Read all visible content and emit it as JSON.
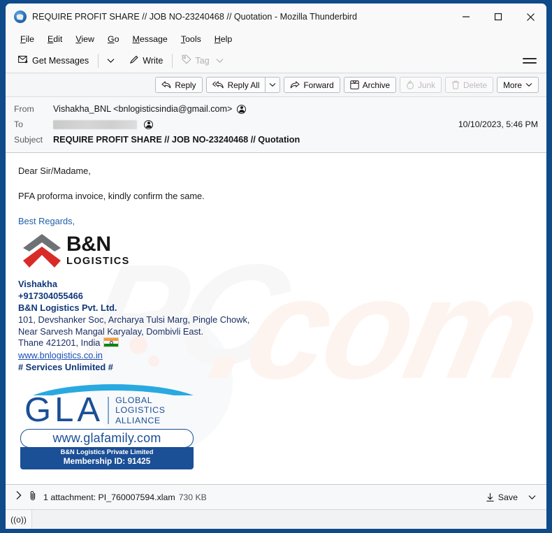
{
  "window": {
    "title": "REQUIRE PROFIT SHARE // JOB NO-23240468 // Quotation - Mozilla Thunderbird",
    "app_icon": "thunderbird-icon",
    "minimize_label": "minimize-icon",
    "maximize_label": "maximize-icon",
    "close_label": "close-icon",
    "border_color": "#0f4a8a"
  },
  "menubar": {
    "items": [
      {
        "accel": "F",
        "rest": "ile"
      },
      {
        "accel": "E",
        "rest": "dit"
      },
      {
        "accel": "V",
        "rest": "iew"
      },
      {
        "accel": "G",
        "rest": "o"
      },
      {
        "accel": "M",
        "rest": "essage"
      },
      {
        "accel": "T",
        "rest": "ools"
      },
      {
        "accel": "H",
        "rest": "elp"
      }
    ]
  },
  "toolbar": {
    "get_messages_label": "Get Messages",
    "get_messages_icon": "envelope-download-icon",
    "get_messages_chevron": "chevron-down-icon",
    "write_label": "Write",
    "write_icon": "pencil-icon",
    "tag_label": "Tag",
    "tag_icon": "tag-icon",
    "tag_chevron": "chevron-down-icon",
    "tag_disabled": true,
    "app_menu_icon": "hamburger-menu-icon"
  },
  "message_actions": [
    {
      "label": "Reply",
      "icon": "reply-arrow-icon",
      "disabled": false
    },
    {
      "label": "Reply All",
      "icon": "reply-all-arrow-icon",
      "disabled": false
    },
    {
      "label": "Forward",
      "icon": "forward-arrow-icon",
      "disabled": false
    },
    {
      "label": "Archive",
      "icon": "archive-box-icon",
      "disabled": false
    },
    {
      "label": "Junk",
      "icon": "junk-flame-icon",
      "disabled": true
    },
    {
      "label": "Delete",
      "icon": "trash-can-icon",
      "disabled": true
    },
    {
      "label": "More",
      "icon": "chevron-down-icon",
      "disabled": false
    }
  ],
  "headers": {
    "from_label": "From",
    "from_value": "Vishakha_BNL <bnlogisticsindia@gmail.com>",
    "from_contact_icon": "contact-add-icon",
    "to_label": "To",
    "to_value": "",
    "to_redacted": true,
    "to_contact_icon": "contact-add-icon",
    "subject_label": "Subject",
    "subject_value": "REQUIRE PROFIT SHARE // JOB NO-23240468 // Quotation",
    "date": "10/10/2023, 5:46 PM"
  },
  "body": {
    "greeting": "Dear Sir/Madame,",
    "paragraph": "PFA proforma invoice, kindly confirm the same.",
    "regards": "Best Regards,",
    "logo": {
      "name": "bn-logistics-logo",
      "brand": "B&N",
      "tagline": "LOGISTICS",
      "chevron_top_color": "#6e7275",
      "chevron_bottom_color": "#d82b28"
    },
    "signature": {
      "name": "Vishakha",
      "phone": "+917304055466",
      "company": "B&N Logistics Pvt. Ltd.",
      "address_line1": "101, Devshanker Soc, Archarya Tulsi Marg, Pingle Chowk,",
      "address_line2": "Near Sarvesh Mangal Karyalay, Dombivli East.",
      "address_line3": "Thane 421201, India",
      "flag_icon": "india-flag-icon",
      "website": "www.bnlogistics.co.in",
      "slogan": "# Services Unlimited #",
      "text_color": "#10387a",
      "link_color": "#1a4fb5"
    },
    "gla_badge": {
      "name": "gla-membership-logo",
      "acronym": "GLA",
      "words_line1": "GLOBAL",
      "words_line2": "LOGISTICS",
      "words_line3": "ALLIANCE",
      "url": "www.glafamily.com",
      "member_company": "B&N Logistics Private Limited",
      "member_id": "Membership ID: 91425",
      "brand_color": "#1b4f96",
      "arc_color": "#29a9e0"
    }
  },
  "attachment": {
    "expand_icon": "chevron-right-icon",
    "paperclip_icon": "paperclip-icon",
    "text": "1 attachment: PI_760007594.xlam",
    "size": "730 KB",
    "save_label": "Save",
    "save_icon": "download-icon",
    "save_chevron": "chevron-down-icon"
  },
  "statusbar": {
    "connection_icon": "((o))"
  },
  "watermark": {
    "text1": "PC",
    "text2": ".com"
  }
}
